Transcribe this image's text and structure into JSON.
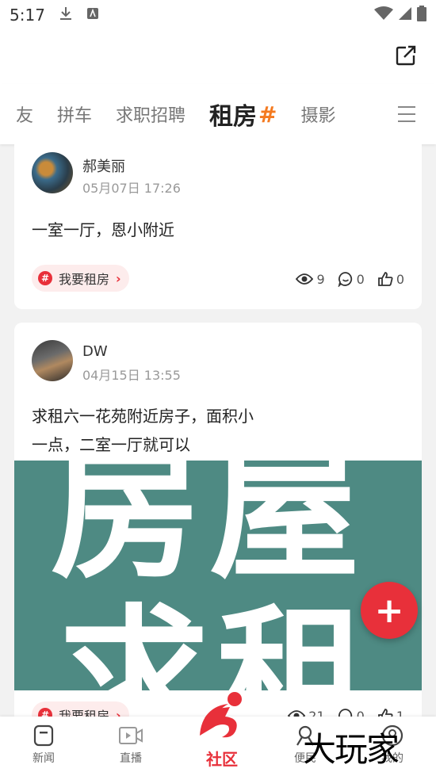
{
  "status_bar": {
    "time": "5:17"
  },
  "tabs": [
    "友",
    "拼车",
    "求职招聘",
    "租房",
    "摄影"
  ],
  "active_tab_hash": "#",
  "posts": [
    {
      "author": "郝美丽",
      "date": "05月07日 17:26",
      "content": "一室一厅，恩小附近",
      "tag": "我要租房",
      "views": "9",
      "comments": "0",
      "likes": "0"
    },
    {
      "author": "DW",
      "date": "04月15日 13:55",
      "content_line1": "求租六一花苑附近房子，面积小",
      "content_line2": "一点，二室一厅就可以",
      "image_text_top": "房屋",
      "image_text_bottom": "求租",
      "tag": "我要租房",
      "views": "21",
      "comments": "0",
      "likes": "1"
    }
  ],
  "fab_label": "+",
  "bottom_nav": {
    "news": "新闻",
    "live": "直播",
    "community": "社区",
    "service": "便民",
    "mine": "我的"
  },
  "watermark": "大玩家",
  "colors": {
    "accent": "#e8303a",
    "tab_hash": "#f47a20",
    "image_bg": "#4e8a83"
  }
}
